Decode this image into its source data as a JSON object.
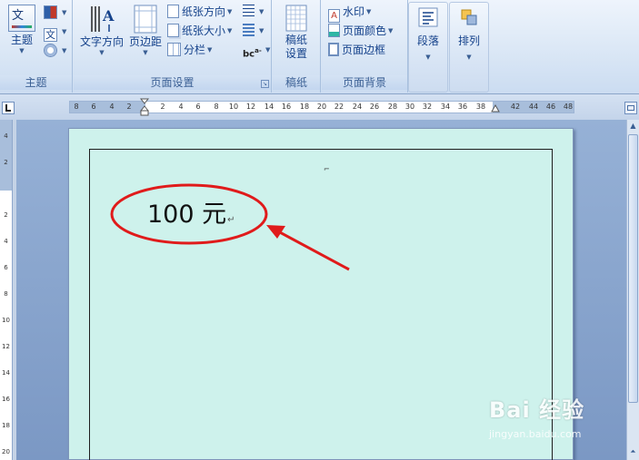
{
  "ribbon": {
    "theme_group": {
      "label": "主题",
      "theme_button": "主题",
      "text_icon_char": "文",
      "font_icon_char": "文"
    },
    "page_setup_group": {
      "label": "页面设置",
      "text_direction": "文字方向",
      "margins": "页边距",
      "orientation": "纸张方向",
      "size": "纸张大小",
      "columns": "分栏"
    },
    "manuscript_group": {
      "label": "稿纸",
      "button_line1": "稿纸",
      "button_line2": "设置"
    },
    "page_background_group": {
      "label": "页面背景",
      "watermark": "水印",
      "page_color": "页面颜色",
      "page_borders": "页面边框"
    },
    "paragraph_button": "段落",
    "arrange_button": "排列"
  },
  "ruler": {
    "ticks": [
      "8",
      "6",
      "4",
      "2",
      "2",
      "4",
      "6",
      "8",
      "10",
      "12",
      "14",
      "16",
      "18",
      "20",
      "22",
      "24",
      "26",
      "28",
      "30",
      "32",
      "34",
      "36",
      "38",
      "42",
      "44",
      "46",
      "48"
    ],
    "vertical_ticks": [
      "4",
      "2",
      "2",
      "4",
      "6",
      "8",
      "10",
      "12",
      "14",
      "16",
      "18",
      "20"
    ]
  },
  "document": {
    "text": "100 元",
    "paragraph_mark": "↵",
    "page_color": "#cef2ec"
  },
  "annotation": {
    "color": "#e01b1b",
    "shape": "ellipse-with-arrow"
  },
  "watermark": {
    "main": "Bai 经验",
    "sub": "jingyan.baidu.com"
  }
}
